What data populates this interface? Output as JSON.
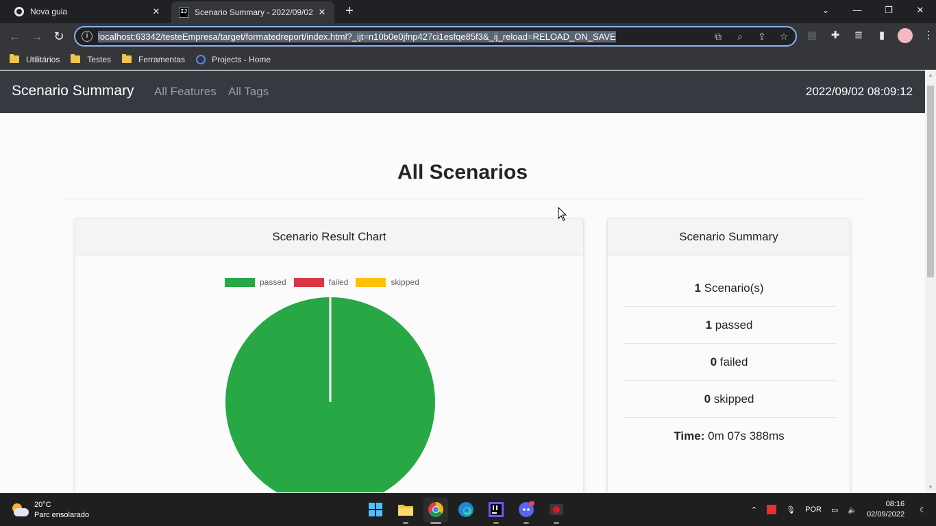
{
  "browser": {
    "tabs": [
      {
        "title": "Nova guia",
        "active": false
      },
      {
        "title": "Scenario Summary - 2022/09/02",
        "active": true
      }
    ],
    "url": "localhost:63342/testeEmpresa/target/formatedreport/index.html?_ijt=n10b0e0jfnp427ci1esfqe85f3&_ij_reload=RELOAD_ON_SAVE",
    "bookmarks": [
      "Utilitários",
      "Testes",
      "Ferramentas",
      "Projects - Home"
    ]
  },
  "navbar": {
    "brand": "Scenario Summary",
    "links": [
      "All Features",
      "All Tags"
    ],
    "timestamp": "2022/09/02 08:09:12"
  },
  "main": {
    "heading": "All Scenarios"
  },
  "chart_card": {
    "title": "Scenario Result Chart"
  },
  "chart_data": {
    "type": "pie",
    "categories": [
      "passed",
      "failed",
      "skipped"
    ],
    "values": [
      1,
      0,
      0
    ],
    "colors": [
      "#28a745",
      "#dc3545",
      "#ffc107"
    ],
    "legend_position": "top"
  },
  "summary_card": {
    "title": "Scenario Summary",
    "rows": [
      {
        "count": "1",
        "label": "Scenario(s)"
      },
      {
        "count": "1",
        "label": "passed"
      },
      {
        "count": "0",
        "label": "failed"
      },
      {
        "count": "0",
        "label": "skipped"
      }
    ],
    "time_label": "Time:",
    "time_value": "0m 07s 388ms"
  },
  "taskbar": {
    "temperature": "20°C",
    "weather": "Parc ensolarado",
    "language": "POR",
    "time": "08:16",
    "date": "02/09/2022"
  }
}
